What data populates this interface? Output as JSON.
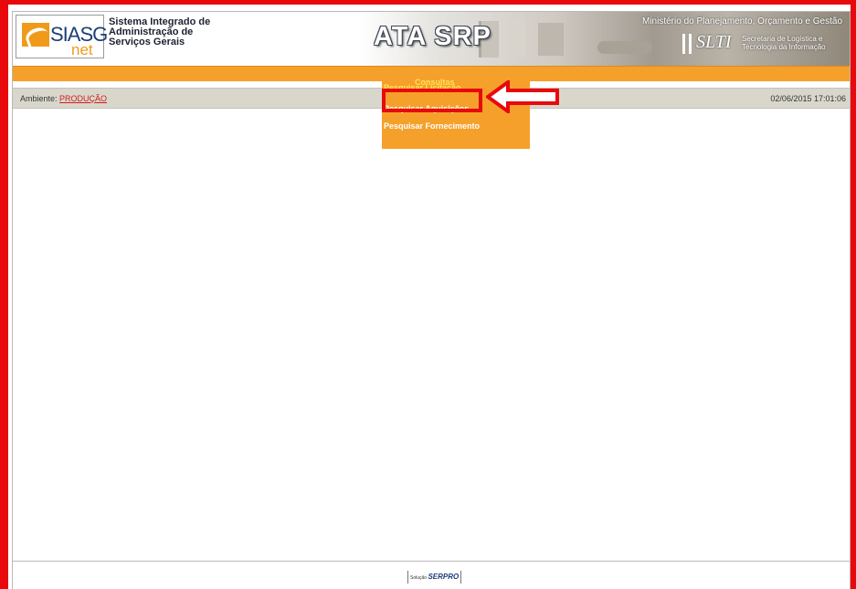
{
  "header": {
    "logo_main": "SIASG",
    "logo_sub": "net",
    "system_name": "Sistema Integrado de\nAdministração de\nServiços Gerais",
    "app_title": "ATA SRP",
    "ministry": "Ministério do Planejamento, Orçamento e Gestão",
    "slti_logo": "SLTI",
    "slti_name": "Secretaria de Logística e\nTecnologia da Informação"
  },
  "menu": {
    "title": "Consultas",
    "items": [
      {
        "label": "Pesquisar Licitação"
      },
      {
        "label": "Pesquisar Aquisições"
      },
      {
        "label": "Pesquisar Fornecimento"
      }
    ]
  },
  "ambient": {
    "label": "Ambiente:",
    "value": "PRODUÇÃO",
    "datetime": "02/06/2015 17:01:06"
  },
  "footer": {
    "solution_label": "Solução",
    "solution_brand": "SERPRO"
  },
  "colors": {
    "nav_orange": "#f5a02a",
    "highlight_yellow": "#ffe45a",
    "annotation_red": "#e8090d",
    "ambient_bar": "#d9d7cc",
    "production_red": "#d21d1d"
  },
  "icons": {
    "logo": "siasg-logo-icon",
    "annotation_arrow": "left-arrow-icon"
  }
}
